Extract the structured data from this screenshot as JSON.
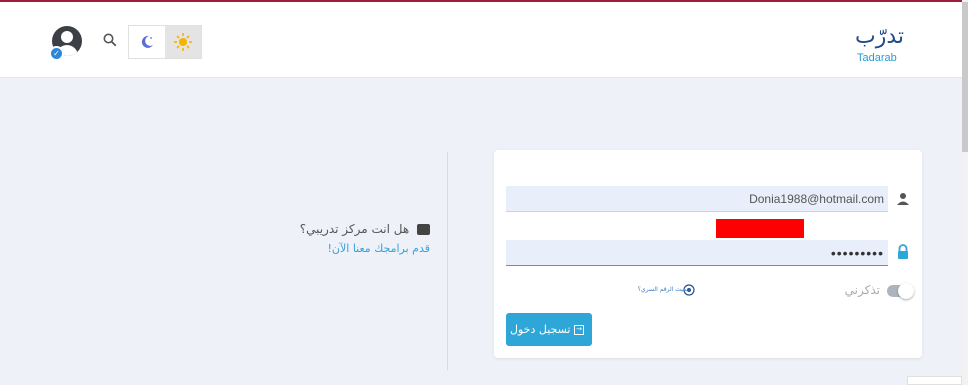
{
  "logo": {
    "arabic": "تدرّب",
    "latin": "Tadarab"
  },
  "header": {
    "avatar_icon": "user-circle-icon",
    "verified_icon": "check-badge-icon",
    "search_icon": "search-icon",
    "moon_icon": "moon-icon",
    "sun_icon": "sun-icon"
  },
  "center": {
    "question": "هل انت مركز تدريبي؟",
    "link": "قدم برامجك معنا الآن!"
  },
  "form": {
    "email_value": "Donia1988@hotmail.com",
    "password_value": "•••••••••",
    "remember_label": "تذكرني",
    "forgot_label": "نسيت الرقم السري؟",
    "login_label": "تسجيل دخول"
  },
  "colors": {
    "accent": "#2ea7d8",
    "brand_dark": "#244b8c",
    "top_line": "#a01c3c",
    "redaction": "#ff0000"
  }
}
